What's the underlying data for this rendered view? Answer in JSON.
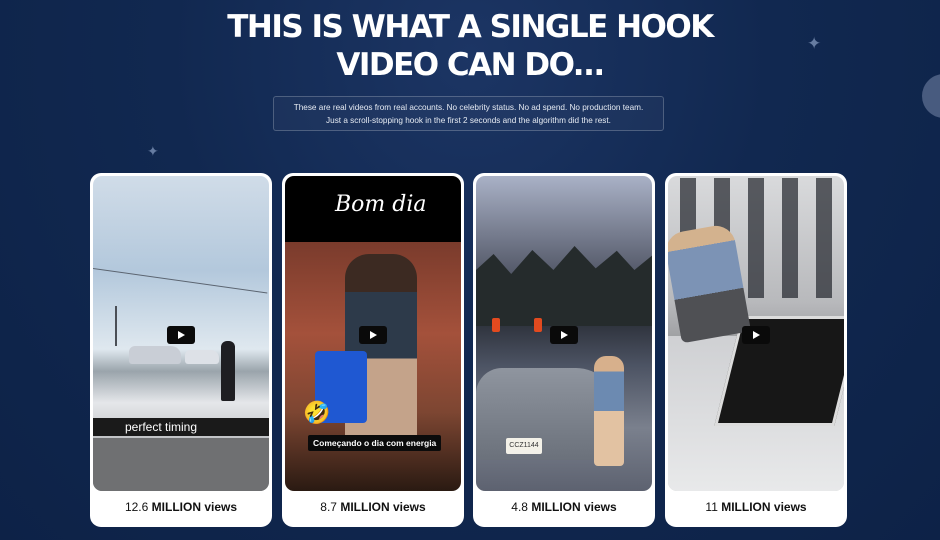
{
  "headline": {
    "line1": "THIS IS WHAT A SINGLE HOOK",
    "line2": "VIDEO CAN DO..."
  },
  "subtitle": {
    "line1": "These are real videos from real accounts. No celebrity status. No ad spend. No production team.",
    "line2": "Just a scroll-stopping hook in the first 2 seconds and the algorithm did the rest."
  },
  "videos": [
    {
      "caption": "perfect timing",
      "views_number": "12.6",
      "views_unit": "MILLION",
      "views_word": "views",
      "play_icon": "play-icon"
    },
    {
      "caption": "Começando o dia com energia",
      "title_overlay": "Bom dia",
      "emoji": "🤣",
      "views_number": "8.7",
      "views_unit": "MILLION",
      "views_word": "views",
      "play_icon": "play-icon"
    },
    {
      "plate": "CCZ1144",
      "views_number": "4.8",
      "views_unit": "MILLION",
      "views_word": "views",
      "play_icon": "play-icon"
    },
    {
      "views_number": "11",
      "views_unit": "MILLION",
      "views_word": "views",
      "play_icon": "play-icon"
    }
  ],
  "colors": {
    "background": "#112850",
    "card": "#ffffff",
    "text_dark": "#111111"
  },
  "icons": [
    "sparkle-icon",
    "play-icon"
  ]
}
